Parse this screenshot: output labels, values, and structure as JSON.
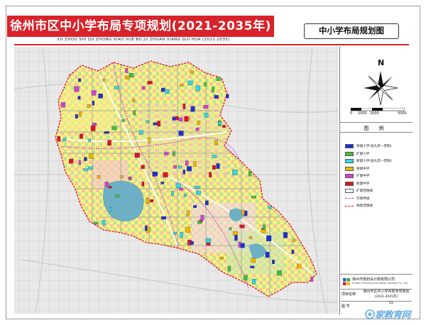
{
  "header": {
    "title": "徐州市区中小学布局专项规划(2021-2035年)",
    "subtitle": "中小学布局规划图",
    "pinyin": "XU ZHOU SHI QU ZHONG XIAO XUE BU JU ZHUAN XIANG GUI HUA (2021-2035)",
    "accent_color": "#d8232a"
  },
  "compass": {
    "north_label": "N",
    "scale_labels": [
      "0",
      "1000",
      "2000",
      "5000"
    ]
  },
  "legend": {
    "title": "图 例",
    "items": [
      {
        "label": "保留小学(含九年一贯制)",
        "kind": "swatch",
        "color": "#1f2fd6"
      },
      {
        "label": "扩建小学",
        "kind": "swatch",
        "color": "#3fc23f"
      },
      {
        "label": "新建小学(含九年一贯制)",
        "kind": "swatch",
        "color": "#2fd8e8"
      },
      {
        "label": "保留中学",
        "kind": "swatch",
        "color": "#f2b400"
      },
      {
        "label": "扩建中学",
        "kind": "swatch",
        "color": "#d43fd4"
      },
      {
        "label": "新建中学",
        "kind": "swatch",
        "color": "#e0102a"
      },
      {
        "label": "扩建范围线",
        "kind": "swatch",
        "color": "#ffffff"
      },
      {
        "label": "行政界线",
        "kind": "line",
        "color": "#c03ad0"
      },
      {
        "label": "规划范围线",
        "kind": "line",
        "color": "#e0102a"
      }
    ]
  },
  "footer": {
    "institute_name": "徐州市规划设计院有限公司",
    "institute_en": "Xuzhou Planning and Design Institute Co., Ltd.",
    "project_label": "项目名称",
    "project_name": "徐州市区中小学布局专项规划",
    "project_year": "(2021-2035年)",
    "drawing_no_label": "图 号",
    "drawing_no": "03"
  },
  "watermark": "家教育网"
}
